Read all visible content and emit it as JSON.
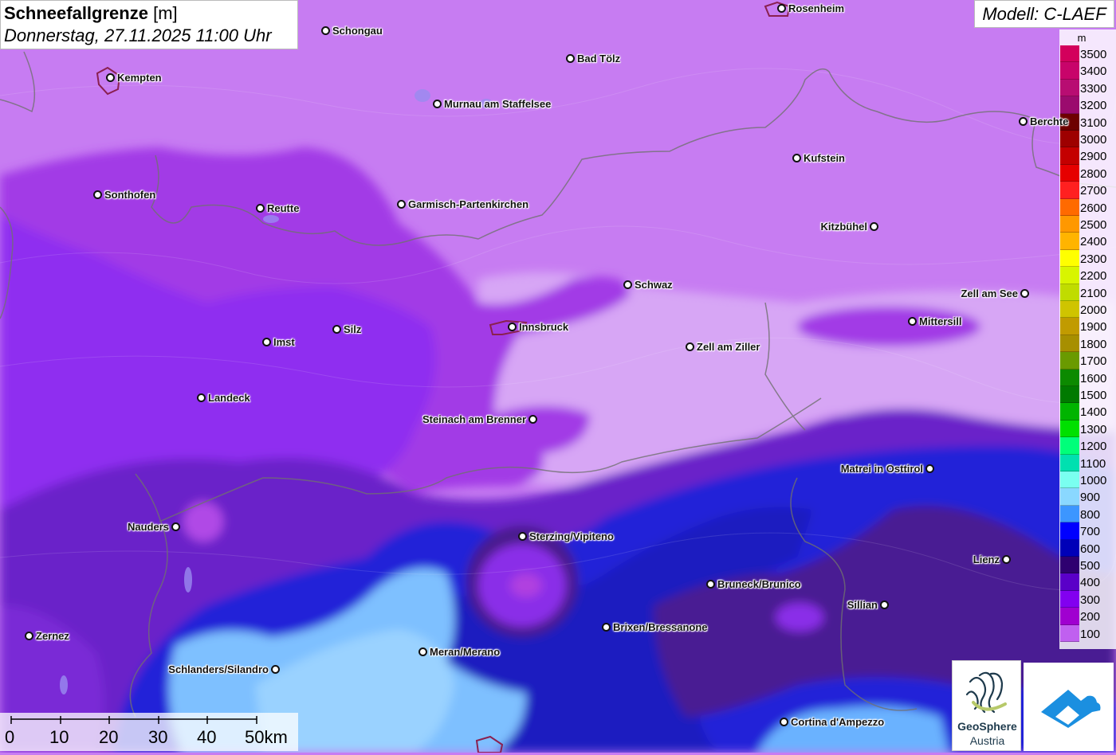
{
  "header": {
    "title": "Schneefallgrenze",
    "unit": "[m]",
    "datetime": "Donnerstag, 27.11.2025 11:00 Uhr"
  },
  "model_label": "Modell: C-LAEF",
  "legend": {
    "unit": "m",
    "entries": [
      {
        "label": "3500",
        "color": "#d3005c"
      },
      {
        "label": "3400",
        "color": "#c8046a"
      },
      {
        "label": "3300",
        "color": "#b80d72"
      },
      {
        "label": "3200",
        "color": "#9b0b6e"
      },
      {
        "label": "3100",
        "color": "#6e0000"
      },
      {
        "label": "3000",
        "color": "#9e0000"
      },
      {
        "label": "2900",
        "color": "#c40000"
      },
      {
        "label": "2800",
        "color": "#e60000"
      },
      {
        "label": "2700",
        "color": "#ff2020"
      },
      {
        "label": "2600",
        "color": "#ff6a00"
      },
      {
        "label": "2500",
        "color": "#ff9800"
      },
      {
        "label": "2400",
        "color": "#ffb400"
      },
      {
        "label": "2300",
        "color": "#ffff00"
      },
      {
        "label": "2200",
        "color": "#d8f500"
      },
      {
        "label": "2100",
        "color": "#c0dc00"
      },
      {
        "label": "2000",
        "color": "#cfc400"
      },
      {
        "label": "1900",
        "color": "#c19b00"
      },
      {
        "label": "1800",
        "color": "#a78f00"
      },
      {
        "label": "1700",
        "color": "#6a9a00"
      },
      {
        "label": "1600",
        "color": "#0c8a00"
      },
      {
        "label": "1500",
        "color": "#007a00"
      },
      {
        "label": "1400",
        "color": "#00b400"
      },
      {
        "label": "1300",
        "color": "#00e000"
      },
      {
        "label": "1200",
        "color": "#00ff7a"
      },
      {
        "label": "1100",
        "color": "#00e0b0"
      },
      {
        "label": "1000",
        "color": "#7afff0"
      },
      {
        "label": "900",
        "color": "#8ad8ff"
      },
      {
        "label": "800",
        "color": "#3c96ff"
      },
      {
        "label": "700",
        "color": "#0000ff"
      },
      {
        "label": "600",
        "color": "#0000b8"
      },
      {
        "label": "500",
        "color": "#2e0070"
      },
      {
        "label": "400",
        "color": "#5a00c8"
      },
      {
        "label": "300",
        "color": "#8200f0"
      },
      {
        "label": "200",
        "color": "#a000d0"
      },
      {
        "label": "100",
        "color": "#c060f0"
      }
    ]
  },
  "cities": [
    {
      "name": "Schongau",
      "side": "r"
    },
    {
      "name": "Rosenheim",
      "side": "r"
    },
    {
      "name": "Kempten",
      "side": "r"
    },
    {
      "name": "Bad Tölz",
      "side": "r"
    },
    {
      "name": "Murnau am Staffelsee",
      "side": "r"
    },
    {
      "name": "Berchte",
      "side": "r"
    },
    {
      "name": "Kufstein",
      "side": "r"
    },
    {
      "name": "Sonthofen",
      "side": "r"
    },
    {
      "name": "Reutte",
      "side": "r"
    },
    {
      "name": "Garmisch-Partenkirchen",
      "side": "r"
    },
    {
      "name": "Kitzbühel",
      "side": "l"
    },
    {
      "name": "Schwaz",
      "side": "r"
    },
    {
      "name": "Zell am See",
      "side": "l"
    },
    {
      "name": "Innsbruck",
      "side": "r"
    },
    {
      "name": "Mittersill",
      "side": "r"
    },
    {
      "name": "Silz",
      "side": "r"
    },
    {
      "name": "Imst",
      "side": "r"
    },
    {
      "name": "Zell am Ziller",
      "side": "r"
    },
    {
      "name": "Landeck",
      "side": "r"
    },
    {
      "name": "Steinach am Brenner",
      "side": "l"
    },
    {
      "name": "Matrei in Osttirol",
      "side": "l"
    },
    {
      "name": "Nauders",
      "side": "l"
    },
    {
      "name": "Sterzing/Vipiteno",
      "side": "r"
    },
    {
      "name": "Lienz",
      "side": "l"
    },
    {
      "name": "Bruneck/Brunico",
      "side": "r"
    },
    {
      "name": "Sillian",
      "side": "l"
    },
    {
      "name": "Brixen/Bressanone",
      "side": "r"
    },
    {
      "name": "Zernez",
      "side": "r"
    },
    {
      "name": "Meran/Merano",
      "side": "r"
    },
    {
      "name": "Schlanders/Silandro",
      "side": "l"
    },
    {
      "name": "Cortina d'Ampezzo",
      "side": "r"
    }
  ],
  "scale": {
    "ticks": [
      "0",
      "10",
      "20",
      "30",
      "40",
      "50km"
    ]
  },
  "logos": {
    "geosphere_name": "GeoSphere",
    "geosphere_sub": "Austria"
  }
}
